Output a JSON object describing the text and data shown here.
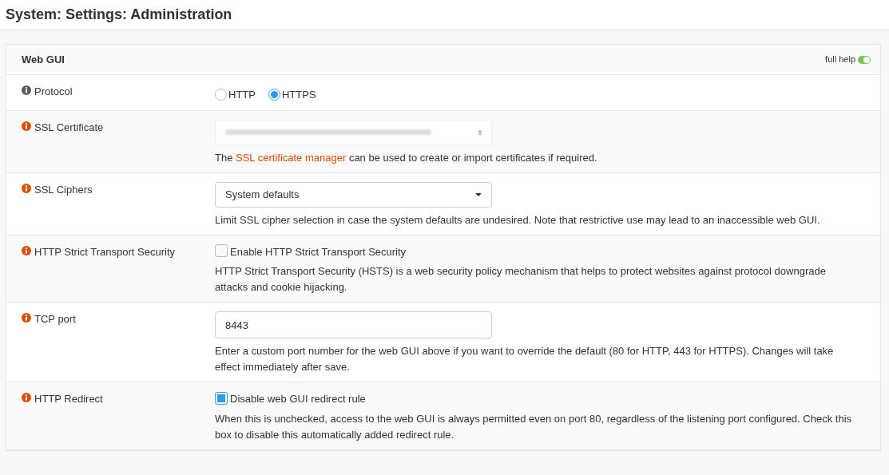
{
  "page_title": "System: Settings: Administration",
  "section": {
    "title": "Web GUI",
    "full_help": {
      "label": "full help",
      "on": true
    }
  },
  "fields": [
    {
      "kind": "radio",
      "label": "Protocol",
      "color": "#5c5c5c",
      "options": [
        {
          "label": "HTTP",
          "selected": false
        },
        {
          "label": "HTTPS",
          "selected": true
        }
      ]
    },
    {
      "kind": "redacted_select",
      "label": "SSL Certificate",
      "color": "#d94f00",
      "help": "The **SSL certificate manager** can be used to create or import certificates if required."
    },
    {
      "kind": "select",
      "label": "SSL Ciphers",
      "color": "#d94f00",
      "value": "System defaults",
      "help": "Limit SSL cipher selection in case the system defaults are undesired. Note that restrictive use may lead to an inaccessible web GUI."
    },
    {
      "kind": "checkbox",
      "label": "HTTP Strict Transport Security",
      "color": "#d94f00",
      "checkbox_label": "Enable HTTP Strict Transport Security",
      "checked": false,
      "help": "HTTP Strict Transport Security (HSTS) is a web security policy mechanism that helps to protect websites against protocol downgrade attacks and cookie hijacking."
    },
    {
      "kind": "text",
      "label": "TCP port",
      "color": "#d94f00",
      "value": "8443",
      "help": "Enter a custom port number for the web GUI above if you want to override the default (80 for HTTP, 443 for HTTPS). Changes will take effect immediately after save."
    },
    {
      "kind": "checkbox",
      "label": "HTTP Redirect",
      "color": "#d94f00",
      "checkbox_label": "Disable web GUI redirect rule",
      "checked": true,
      "help": "When this is unchecked, access to the web GUI is always permitted even on port 80, regardless of the listening port configured. Check this box to disable this automatically added redirect rule."
    }
  ]
}
